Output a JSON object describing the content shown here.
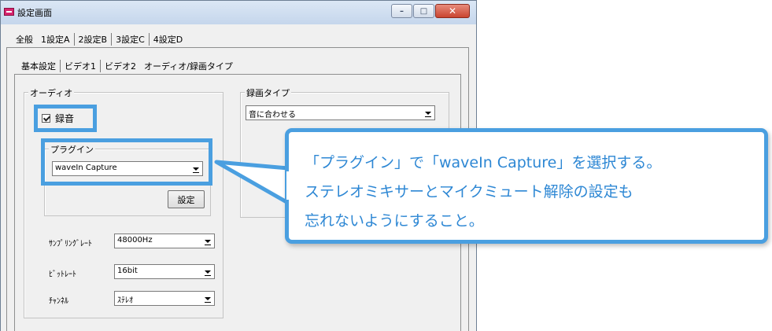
{
  "window": {
    "title": "設定画面",
    "controls": {
      "minimize": "–",
      "maximize": "□",
      "close": "✕"
    }
  },
  "main_tabs": [
    "全般",
    "1設定A",
    "2設定B",
    "3設定C",
    "4設定D"
  ],
  "sub_tabs": [
    "基本設定",
    "ビデオ1",
    "ビデオ2",
    "オーディオ/録画タイプ"
  ],
  "audio": {
    "group_label": "オーディオ",
    "record_checkbox": {
      "label": "録音",
      "checked": true
    },
    "plugin": {
      "group_label": "プラグイン",
      "selected": "waveIn Capture",
      "settings_button": "設定"
    },
    "sampling_rate": {
      "label": "ｻﾝﾌﾟﾘﾝｸﾞﾚｰﾄ",
      "value": "48000Hz"
    },
    "bit_rate": {
      "label": "ﾋﾞｯﾄﾚｰﾄ",
      "value": "16bit"
    },
    "channel": {
      "label": "ﾁｬﾝﾈﾙ",
      "value": "ｽﾃﾚｵ"
    }
  },
  "record_type": {
    "group_label": "録画タイプ",
    "selected": "音に合わせる"
  },
  "callout": {
    "lines": [
      "「プラグイン」で「waveIn Capture」を選択する。",
      "ステレオミキサーとマイクミュート解除の設定も",
      "忘れないようにすること。"
    ]
  },
  "colors": {
    "highlight": "#4a9fe0",
    "callout_text": "#2d87d4"
  }
}
